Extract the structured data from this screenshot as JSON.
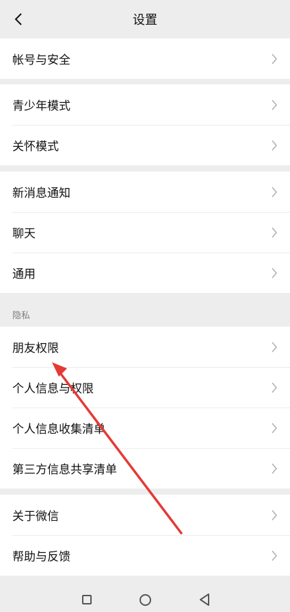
{
  "header": {
    "title": "设置",
    "back_icon": "chevron-left-icon"
  },
  "groups": [
    {
      "items": [
        {
          "label": "帐号与安全"
        }
      ]
    },
    {
      "items": [
        {
          "label": "青少年模式"
        },
        {
          "label": "关怀模式"
        }
      ]
    },
    {
      "items": [
        {
          "label": "新消息通知"
        },
        {
          "label": "聊天"
        },
        {
          "label": "通用"
        }
      ]
    },
    {
      "items": [
        {
          "label": "朋友权限"
        },
        {
          "label": "个人信息与权限"
        },
        {
          "label": "个人信息收集清单"
        },
        {
          "label": "第三方信息共享清单"
        }
      ]
    },
    {
      "items": [
        {
          "label": "关于微信"
        },
        {
          "label": "帮助与反馈"
        }
      ]
    }
  ],
  "section": {
    "privacy_label": "隐私"
  },
  "navbar": {
    "icons": [
      "square-icon",
      "circle-icon",
      "triangle-back-icon"
    ]
  },
  "annotation": {
    "arrow_color": "#e53935"
  }
}
